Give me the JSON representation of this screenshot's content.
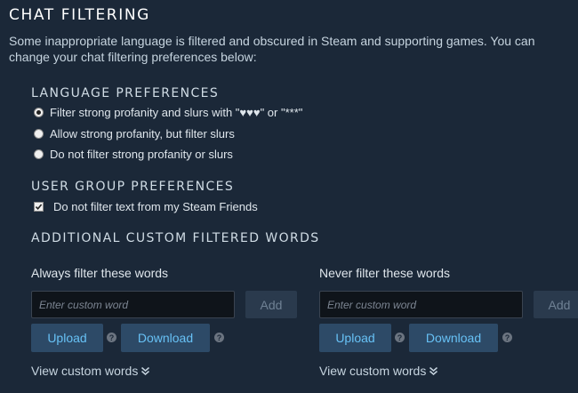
{
  "header": {
    "title": "CHAT FILTERING",
    "description": "Some inappropriate language is filtered and obscured in Steam and supporting games. You can change your chat filtering preferences below:"
  },
  "language": {
    "heading": "LANGUAGE PREFERENCES",
    "options": [
      {
        "label": "Filter strong profanity and slurs with \"♥♥♥\" or \"***\"",
        "selected": true
      },
      {
        "label": "Allow strong profanity, but filter slurs",
        "selected": false
      },
      {
        "label": "Do not filter strong profanity or slurs",
        "selected": false
      }
    ]
  },
  "user_group": {
    "heading": "USER GROUP PREFERENCES",
    "checkbox_label": "Do not filter text from my Steam Friends",
    "checked": true
  },
  "custom_words": {
    "heading": "ADDITIONAL CUSTOM FILTERED WORDS",
    "always": {
      "label": "Always filter these words",
      "placeholder": "Enter custom word",
      "add_label": "Add",
      "upload_label": "Upload",
      "download_label": "Download",
      "help_glyph": "?",
      "view_label": "View custom words"
    },
    "never": {
      "label": "Never filter these words",
      "placeholder": "Enter custom word",
      "add_label": "Add",
      "upload_label": "Upload",
      "download_label": "Download",
      "help_glyph": "?",
      "view_label": "View custom words"
    }
  },
  "colors": {
    "background": "#1b2838",
    "button": "#2d4a67",
    "button_text": "#67c1f5",
    "add_button": "#2a3a4d"
  }
}
